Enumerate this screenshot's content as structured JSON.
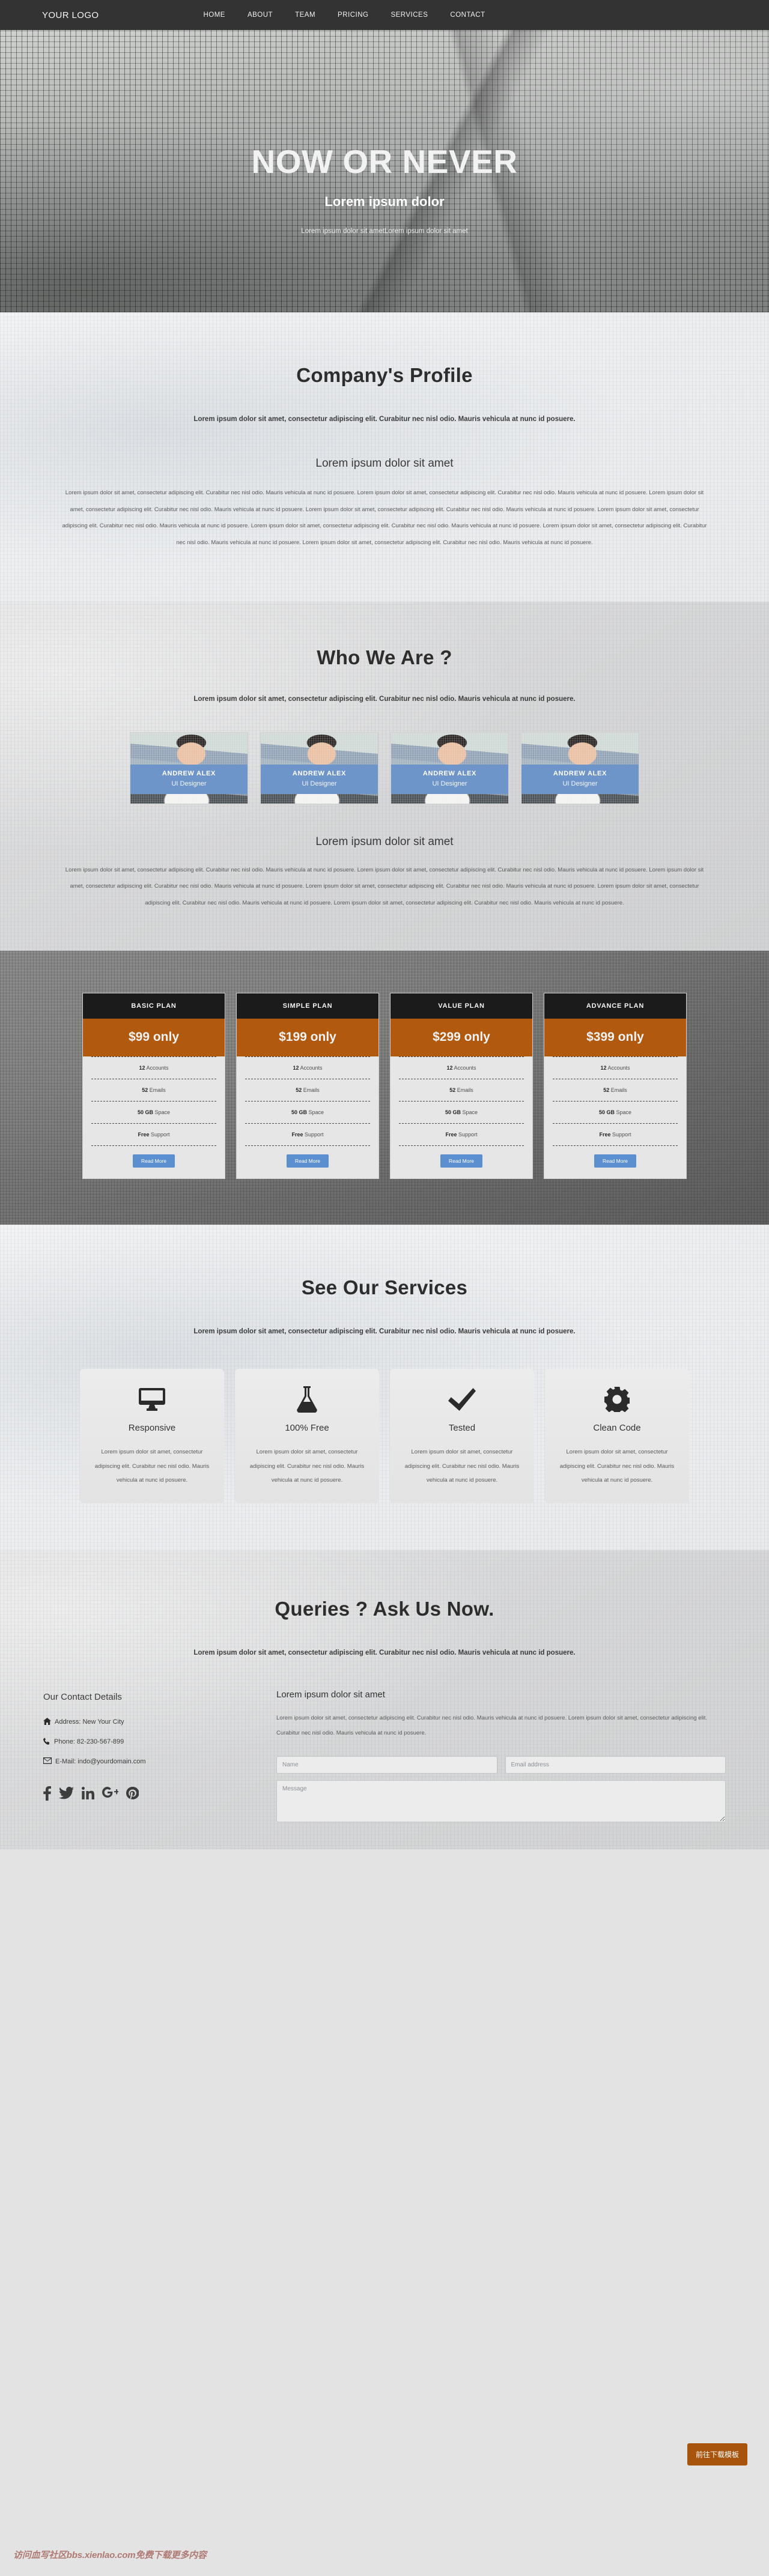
{
  "nav": {
    "logo": "YOUR LOGO",
    "links": [
      {
        "label": "HOME"
      },
      {
        "label": "ABOUT"
      },
      {
        "label": "TEAM"
      },
      {
        "label": "PRICING"
      },
      {
        "label": "SERVICES"
      },
      {
        "label": "CONTACT"
      }
    ]
  },
  "hero": {
    "title": "NOW OR NEVER",
    "subtitle": "Lorem ipsum dolor",
    "tagline": "Lorem ipsum dolor sit ametLorem ipsum dolor sit amet"
  },
  "profile": {
    "heading": "Company's Profile",
    "lead": "Lorem ipsum dolor sit amet, consectetur adipiscing elit. Curabitur nec nisl odio. Mauris vehicula at nunc id posuere.",
    "subheading": "Lorem ipsum dolor sit amet",
    "body": "Lorem ipsum dolor sit amet, consectetur adipiscing elit. Curabitur nec nisl odio. Mauris vehicula at nunc id posuere. Lorem ipsum dolor sit amet, consectetur adipiscing elit. Curabitur nec nisl odio. Mauris vehicula at nunc id posuere. Lorem ipsum dolor sit amet, consectetur adipiscing elit. Curabitur nec nisl odio. Mauris vehicula at nunc id posuere. Lorem ipsum dolor sit amet, consectetur adipiscing elit. Curabitur nec nisl odio. Mauris vehicula at nunc id posuere. Lorem ipsum dolor sit amet, consectetur adipiscing elit. Curabitur nec nisl odio. Mauris vehicula at nunc id posuere. Lorem ipsum dolor sit amet, consectetur adipiscing elit. Curabitur nec nisl odio. Mauris vehicula at nunc id posuere. Lorem ipsum dolor sit amet, consectetur adipiscing elit. Curabitur nec nisl odio. Mauris vehicula at nunc id posuere. Lorem ipsum dolor sit amet, consectetur adipiscing elit. Curabitur nec nisl odio. Mauris vehicula at nunc id posuere."
  },
  "team": {
    "heading": "Who We Are ?",
    "lead": "Lorem ipsum dolor sit amet, consectetur adipiscing elit. Curabitur nec nisl odio. Mauris vehicula at nunc id posuere.",
    "members": [
      {
        "name": "ANDREW ALEX",
        "role": "UI Designer"
      },
      {
        "name": "ANDREW ALEX",
        "role": "UI Designer"
      },
      {
        "name": "ANDREW ALEX",
        "role": "UI Designer"
      },
      {
        "name": "ANDREW ALEX",
        "role": "UI Designer"
      }
    ],
    "subheading": "Lorem ipsum dolor sit amet",
    "body": "Lorem ipsum dolor sit amet, consectetur adipiscing elit. Curabitur nec nisl odio. Mauris vehicula at nunc id posuere. Lorem ipsum dolor sit amet, consectetur adipiscing elit. Curabitur nec nisl odio. Mauris vehicula at nunc id posuere. Lorem ipsum dolor sit amet, consectetur adipiscing elit. Curabitur nec nisl odio. Mauris vehicula at nunc id posuere. Lorem ipsum dolor sit amet, consectetur adipiscing elit. Curabitur nec nisl odio. Mauris vehicula at nunc id posuere. Lorem ipsum dolor sit amet, consectetur adipiscing elit. Curabitur nec nisl odio. Mauris vehicula at nunc id posuere. Lorem ipsum dolor sit amet, consectetur adipiscing elit. Curabitur nec nisl odio. Mauris vehicula at nunc id posuere."
  },
  "pricing": {
    "plans": [
      {
        "name": "BASIC PLAN",
        "price": "$99 only",
        "features": [
          {
            "strong": "12",
            "text": " Accounts"
          },
          {
            "strong": "52",
            "text": " Emails"
          },
          {
            "strong": "50 GB",
            "text": " Space"
          },
          {
            "strong": "Free",
            "text": " Support"
          }
        ],
        "button": "Read More"
      },
      {
        "name": "SIMPLE PLAN",
        "price": "$199 only",
        "features": [
          {
            "strong": "12",
            "text": " Accounts"
          },
          {
            "strong": "52",
            "text": " Emails"
          },
          {
            "strong": "50 GB",
            "text": " Space"
          },
          {
            "strong": "Free",
            "text": " Support"
          }
        ],
        "button": "Read More"
      },
      {
        "name": "VALUE PLAN",
        "price": "$299 only",
        "features": [
          {
            "strong": "12",
            "text": " Accounts"
          },
          {
            "strong": "52",
            "text": " Emails"
          },
          {
            "strong": "50 GB",
            "text": " Space"
          },
          {
            "strong": "Free",
            "text": " Support"
          }
        ],
        "button": "Read More"
      },
      {
        "name": "ADVANCE PLAN",
        "price": "$399 only",
        "features": [
          {
            "strong": "12",
            "text": " Accounts"
          },
          {
            "strong": "52",
            "text": " Emails"
          },
          {
            "strong": "50 GB",
            "text": " Space"
          },
          {
            "strong": "Free",
            "text": " Support"
          }
        ],
        "button": "Read More"
      }
    ]
  },
  "services": {
    "heading": "See Our Services",
    "lead": "Lorem ipsum dolor sit amet, consectetur adipiscing elit. Curabitur nec nisl odio. Mauris vehicula at nunc id posuere.",
    "items": [
      {
        "icon": "monitor-icon",
        "title": "Responsive",
        "text": "Lorem ipsum dolor sit amet, consectetur adipiscing elit. Curabitur nec nisl odio. Mauris vehicula at nunc id posuere."
      },
      {
        "icon": "flask-icon",
        "title": "100% Free",
        "text": "Lorem ipsum dolor sit amet, consectetur adipiscing elit. Curabitur nec nisl odio. Mauris vehicula at nunc id posuere."
      },
      {
        "icon": "check-icon",
        "title": "Tested",
        "text": "Lorem ipsum dolor sit amet, consectetur adipiscing elit. Curabitur nec nisl odio. Mauris vehicula at nunc id posuere."
      },
      {
        "icon": "gear-icon",
        "title": "Clean Code",
        "text": "Lorem ipsum dolor sit amet, consectetur adipiscing elit. Curabitur nec nisl odio. Mauris vehicula at nunc id posuere."
      }
    ]
  },
  "contact": {
    "heading": "Queries ? Ask Us Now.",
    "lead": "Lorem ipsum dolor sit amet, consectetur adipiscing elit. Curabitur nec nisl odio. Mauris vehicula at nunc id posuere.",
    "details_title": "Our Contact Details",
    "address": "Address: New Your City",
    "phone": "Phone: 82-230-567-899",
    "email": "E-Mail: indo@yourdomain.com",
    "socials": [
      {
        "name": "facebook-icon"
      },
      {
        "name": "twitter-icon"
      },
      {
        "name": "linkedin-icon"
      },
      {
        "name": "googleplus-icon"
      },
      {
        "name": "pinterest-icon"
      }
    ],
    "form_title": "Lorem ipsum dolor sit amet",
    "form_text": "Lorem ipsum dolor sit amet, consectetur adipiscing elit. Curabitur nec nisl odio. Mauris vehicula at nunc id posuere. Lorem ipsum dolor sit amet, consectetur adipiscing elit. Curabitur nec nisl odio. Mauris vehicula at nunc id posuere.",
    "name_placeholder": "Name",
    "email_placeholder": "Email address",
    "message_placeholder": "Message"
  },
  "overlay": {
    "download_button": "前往下载模板",
    "watermark": "访问血写社区bbs.xienlao.com免费下载更多内容"
  },
  "colors": {
    "navbar": "#333333",
    "price_accent": "#b0590f",
    "team_accent": "#6e95c9",
    "button_blue": "#5b8fd0",
    "badge_orange": "#a8540d"
  }
}
